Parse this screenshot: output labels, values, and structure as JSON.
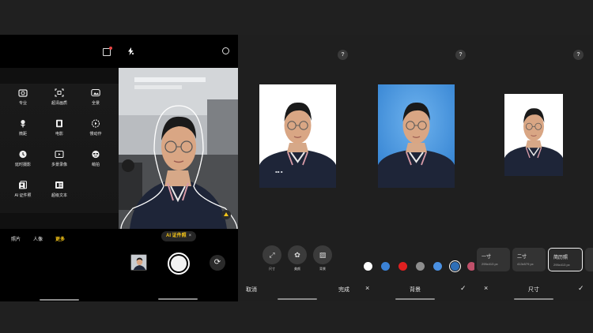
{
  "more_modes": {
    "modes": [
      {
        "label": "专业",
        "icon": "pro-mode-icon"
      },
      {
        "label": "超清画质",
        "icon": "super-resolution-icon"
      },
      {
        "label": "全景",
        "icon": "panorama-icon"
      },
      {
        "label": "微距",
        "icon": "macro-flower-icon"
      },
      {
        "label": "电影",
        "icon": "film-icon"
      },
      {
        "label": "慢动作",
        "icon": "slow-motion-icon"
      },
      {
        "label": "延时摄影",
        "icon": "timelapse-clock-icon"
      },
      {
        "label": "多景录像",
        "icon": "multi-view-video-icon"
      },
      {
        "label": "萌拍",
        "icon": "cute-face-icon"
      },
      {
        "label": "AI 证件照",
        "icon": "id-photo-icon"
      },
      {
        "label": "超级文本",
        "icon": "super-text-icon"
      }
    ],
    "tabs": [
      "照片",
      "人像",
      "更多"
    ]
  },
  "viewfinder": {
    "badge_label": "AI 证件照",
    "badge_close": "×"
  },
  "editor_home": {
    "tools": [
      "尺寸",
      "美颜",
      "背景"
    ],
    "cancel_label": "取消",
    "done_label": "完成"
  },
  "background_editor": {
    "colors": [
      "#ffffff",
      "#3b82d6",
      "#e02020",
      "#8e8e8e",
      "#4a90e2",
      "#2f6fb8",
      "#c0506a"
    ],
    "selected_index": 5,
    "title": "背景",
    "cancel_symbol": "×",
    "confirm_symbol": "✓"
  },
  "size_editor": {
    "sizes": [
      {
        "name": "一寸",
        "dims": "295x413 px"
      },
      {
        "name": "二寸",
        "dims": "413x579 px"
      },
      {
        "name": "简历照",
        "dims": "295x413 px"
      }
    ],
    "selected_index": 2,
    "title": "尺寸",
    "cancel_symbol": "×",
    "confirm_symbol": "✓"
  }
}
